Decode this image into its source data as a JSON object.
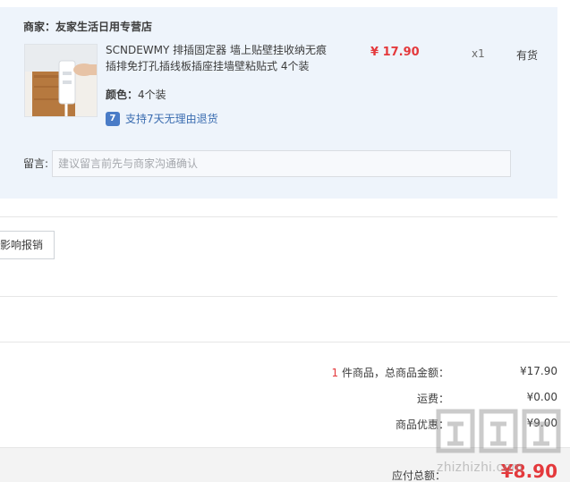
{
  "order": {
    "seller_label": "商家：友家生活日用专营店",
    "item": {
      "title": "SCNDEWMY 排插固定器 墙上贴壁挂收纳无痕插排免打孔插线板插座挂墙壁粘贴式 4个装",
      "price": "¥ 17.90",
      "quantity": "x1",
      "stock": "有货",
      "attr_label": "颜色：",
      "attr_value": "4个装",
      "return_policy": "支持7天无理由退货"
    },
    "message": {
      "label": "留言:",
      "placeholder": "建议留言前先与商家沟通确认"
    }
  },
  "mid_button_label": "影响报销",
  "summary": {
    "count": "1",
    "count_label": "件商品，总商品金额：",
    "total_value": "¥17.90",
    "shipping_label": "运费：",
    "shipping_value": "¥0.00",
    "discount_label": "商品优惠：",
    "discount_value": "¥9.00",
    "payable_label": "应付总额：",
    "payable_value": "¥8.90"
  },
  "watermark": {
    "text": "zhizhizhi.com"
  },
  "colors": {
    "panel_bg": "#eef4fb",
    "price_red": "#e4393c",
    "link_blue": "#3a6cb0"
  }
}
